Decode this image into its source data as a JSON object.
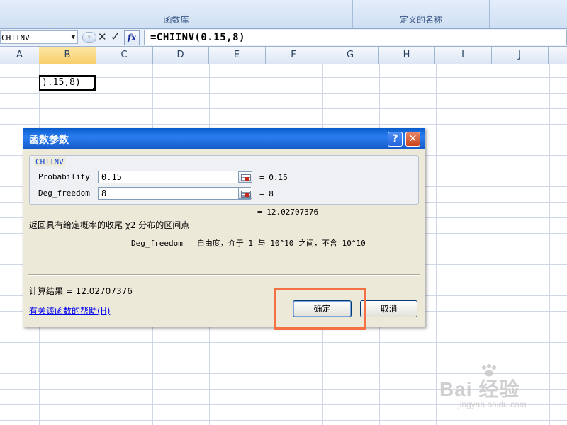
{
  "ribbon": {
    "groups": [
      {
        "caption": "函数库"
      },
      {
        "caption": "定义的名称"
      },
      {
        "caption": ""
      }
    ]
  },
  "formula_bar": {
    "name_box": "CHIINV",
    "formula": "=CHIINV(0.15,8)"
  },
  "sheet": {
    "columns": [
      "A",
      "B",
      "C",
      "D",
      "E",
      "F",
      "G",
      "H",
      "I",
      "J"
    ],
    "selected_column": "B",
    "active_cell_text": ").15,8)"
  },
  "dialog": {
    "title": "函数参数",
    "function_name": "CHIINV",
    "args": [
      {
        "label": "Probability",
        "value": "0.15",
        "result": "= 0.15"
      },
      {
        "label": "Deg_freedom",
        "value": "8",
        "result": "= 8"
      }
    ],
    "overall_result": "= 12.02707376",
    "description": "返回具有给定概率的收尾 χ2 分布的区间点",
    "arg_description_name": "Deg_freedom",
    "arg_description_text": "自由度，介于 1 与 10^10 之间，不含 10^10",
    "calc_result": "计算结果 = 12.02707376",
    "help_link": "有关该函数的帮助(H)",
    "ok_label": "确定",
    "cancel_label": "取消",
    "help_button": "?",
    "close_button": "✕"
  },
  "colors": {
    "titlebar": "#1558c8",
    "highlight": "#f47143",
    "link": "#0000ee"
  },
  "watermark": {
    "main": "Bai 经验",
    "sub": "jingyan.baidu.com"
  }
}
